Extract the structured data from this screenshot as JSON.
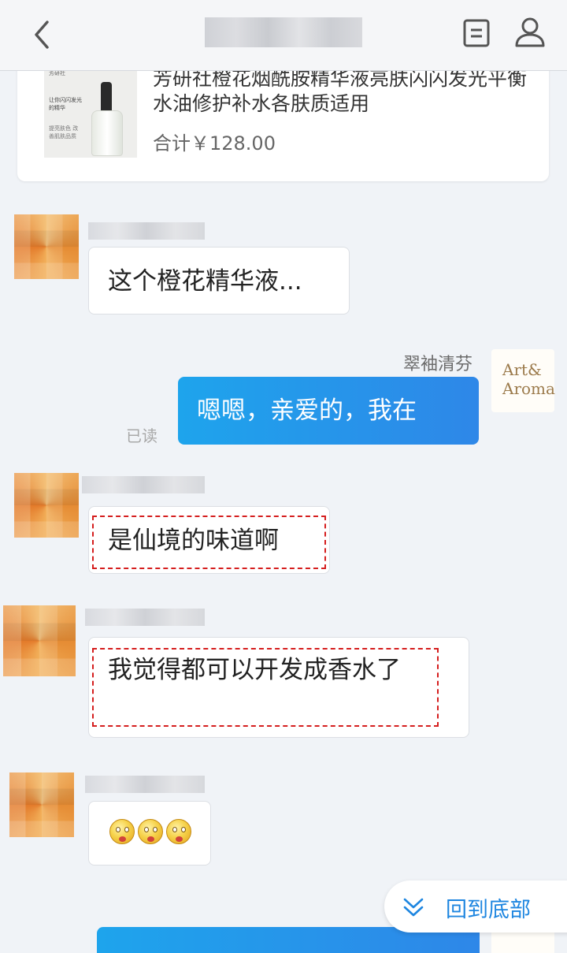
{
  "header": {
    "back_icon": "chevron-left-icon",
    "doc_icon": "document-icon",
    "user_icon": "user-icon"
  },
  "order": {
    "thumb_brand": "芳研社",
    "thumb_slogan": "让你闪闪发光的精华",
    "thumb_sub": "提亮肤色 改善肌肤品质",
    "name": "芳研社橙花烟酰胺精华液亮肤闪闪发光平衡水油修护补水各肤质适用",
    "total": "合计￥128.00"
  },
  "messages": [
    {
      "text": "这个橙花精华液..."
    },
    {
      "sender": "翠袖清芬",
      "text": "嗯嗯，亲爱的，我在",
      "status": "已读"
    },
    {
      "text": "是仙境的味道啊"
    },
    {
      "text": "我觉得都可以开发成香水了"
    },
    {
      "emoji": "surprised-face-emoji"
    }
  ],
  "brand_avatar": {
    "line1": "Art",
    "line2": "& ",
    "line3": "Aroma"
  },
  "back_to_bottom": {
    "label": "回到底部",
    "icon": "double-chevron-down-icon"
  },
  "colors": {
    "accent": "#1e86e0",
    "bubble_out": "#2196ea",
    "highlight": "#d51e1e",
    "background": "#f0f3f7"
  }
}
